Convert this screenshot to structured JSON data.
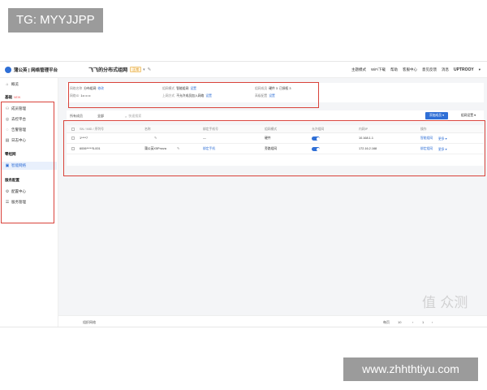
{
  "overlay_tags": {
    "top_left": "TG: MYYJJPP",
    "bottom_right": "www.zhhthtiyu.com"
  },
  "watermark": {
    "text": "值 众测"
  },
  "colors": {
    "accent": "#2f6fd6",
    "annotation": "#d9423a"
  },
  "header": {
    "brand": "蒲公英 | 网络管理平台",
    "network_name": "飞飞的分布式组网",
    "network_badge": "正常",
    "right_links": [
      "主题模式",
      "WiFi下载",
      "帮助",
      "客服中心",
      "意见反馈",
      "消息"
    ],
    "user": "UPTROOY"
  },
  "sidebar": {
    "overview": "概览",
    "section_basic": "基础",
    "new_badge": "NEW",
    "items_basic": [
      "成员管理",
      "去控平台",
      "告警管理",
      "日志中心"
    ],
    "section_network": "零组网",
    "active_item": "智能网络",
    "section_service": "服务配置",
    "items_service": [
      "配置中心",
      "服务管理"
    ]
  },
  "info_panel": {
    "row1": [
      {
        "label": "网络名称",
        "value": "分布组网",
        "link": "修改"
      },
      {
        "label": "组网模式",
        "value": "智能组网",
        "link": "设置"
      },
      {
        "label": "组网成员",
        "value": "硬件 3",
        "link": "已授权 3"
      }
    ],
    "row2": [
      {
        "label": "网络ID",
        "value": "1•• •• ••",
        "link": ""
      },
      {
        "label": "上网方式",
        "value": "不允许成员加入网络",
        "link": "设置"
      },
      {
        "label": "高级配置",
        "value": "",
        "link": "设置"
      }
    ]
  },
  "filter_bar": {
    "label": "所有成员",
    "select_value": "全部",
    "search_placeholder": "快速搜索",
    "primary_button": "添加成员 ▾",
    "secondary_button": "组网设置 ▾"
  },
  "table": {
    "columns": [
      "SN / MID / 序列号",
      "名称",
      "绑定手机号",
      "组网模式",
      "允许组网",
      "内网IP",
      "操作"
    ],
    "rows": [
      {
        "sn": "1****7",
        "name": "",
        "phone": "—",
        "mode": "硬件",
        "enabled": true,
        "ip": "10.168.1.1",
        "ops": [
          "智能组网",
          "更多 ▾"
        ]
      },
      {
        "sn": "6006*****5-001",
        "name": "蒲公英X5Pnova",
        "phone": "绑定手机",
        "mode": "旁路组网",
        "enabled": true,
        "ip": "172.16.2.168",
        "ops": [
          "绑定组网",
          "更多 ▾"
        ]
      }
    ]
  },
  "footer": {
    "left": "组织网络",
    "right": [
      "每页",
      "10",
      "‹",
      "1",
      "›"
    ]
  }
}
